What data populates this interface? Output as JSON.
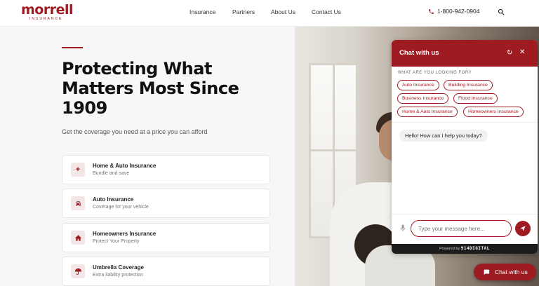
{
  "brand": {
    "logo": "morrell",
    "logo_sub": "INSURANCE",
    "color": "#9e1b22"
  },
  "nav": {
    "items": [
      "Insurance",
      "Partners",
      "About Us",
      "Contact Us"
    ],
    "phone": "1-800-942-0904"
  },
  "hero": {
    "headline": "Protecting What Matters Most Since 1909",
    "subhead": "Get the coverage you need at a price you can afford",
    "cards": [
      {
        "title": "Home & Auto Insurance",
        "sub": "Bundle and save",
        "icon": "plus-icon"
      },
      {
        "title": "Auto Insurance",
        "sub": "Coverage for your vehicle",
        "icon": "car-icon"
      },
      {
        "title": "Homeowners Insurance",
        "sub": "Protect Your Property",
        "icon": "house-icon"
      },
      {
        "title": "Umbrella Coverage",
        "sub": "Extra liability protection",
        "icon": "umbrella-icon"
      }
    ]
  },
  "chat": {
    "title": "Chat with us",
    "prompt": "WHAT ARE YOU LOOKING FOR?",
    "chips": [
      "Auto Insurance",
      "Building Insurance",
      "Business Insurance",
      "Flood Insurance",
      "Home & Auto Insurance",
      "Homeowners Insurance"
    ],
    "greeting": "Hello! How can I help you today?",
    "placeholder": "Type your message here...",
    "powered_by": "Powered by",
    "powered_brand": "914DIGITAL",
    "launcher_label": "Chat with us"
  }
}
